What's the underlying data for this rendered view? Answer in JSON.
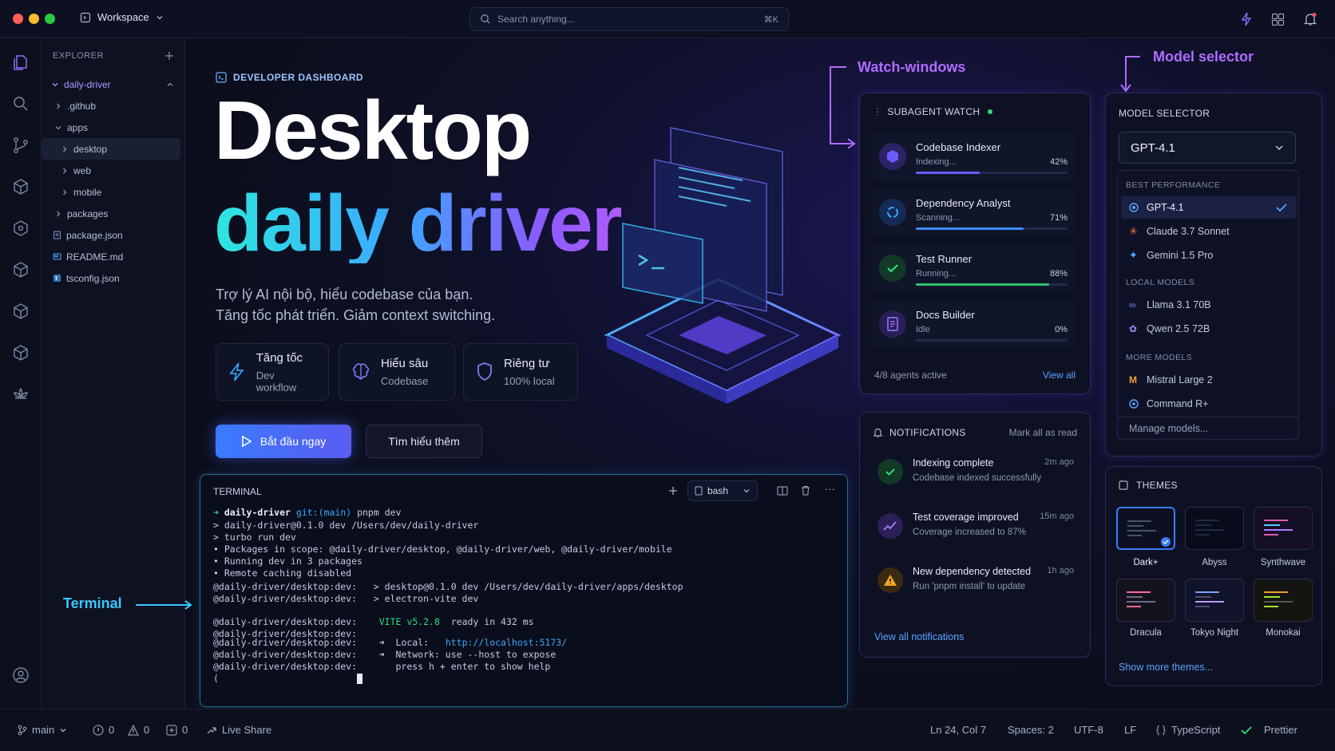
{
  "titlebar": {
    "workspace": "Workspace",
    "search_placeholder": "Search anything...",
    "search_shortcut": "⌘K"
  },
  "explorer": {
    "title": "EXPLORER",
    "items": [
      {
        "label": "daily-driver",
        "icon": "chevron-down-icon"
      },
      {
        "label": ".github",
        "icon": "chevron-right-icon"
      },
      {
        "label": "apps",
        "icon": "chevron-down-icon"
      },
      {
        "label": "desktop",
        "icon": "chevron-right-icon"
      },
      {
        "label": "web",
        "icon": "chevron-right-icon"
      },
      {
        "label": "mobile",
        "icon": "chevron-right-icon"
      },
      {
        "label": "packages",
        "icon": "chevron-right-icon"
      },
      {
        "label": "package.json",
        "icon": "json-file-icon"
      },
      {
        "label": "README.md",
        "icon": "markdown-file-icon"
      },
      {
        "label": "tsconfig.json",
        "icon": "ts-file-icon"
      }
    ]
  },
  "hero": {
    "label": "DEVELOPER DASHBOARD",
    "title": "Desktop",
    "title_gradient": "daily driver",
    "sub1": "Trợ lý AI nội bộ, hiểu codebase của bạn.",
    "sub2": "Tăng tốc phát triển. Giảm context switching.",
    "features": [
      {
        "title": "Tăng tốc",
        "sub": "Dev workflow",
        "icon": "lightning-icon"
      },
      {
        "title": "Hiểu sâu",
        "sub": "Codebase",
        "icon": "brain-icon"
      },
      {
        "title": "Riêng tư",
        "sub": "100% local",
        "icon": "shield-icon"
      }
    ],
    "cta_primary": "Bắt đầu ngay",
    "cta_secondary": "Tìm hiểu thêm"
  },
  "terminal": {
    "title": "TERMINAL",
    "shell": "bash",
    "prompt_dir": "daily-driver",
    "prompt_git": "git:(main)",
    "prompt_cmd": "pnpm dev",
    "lines": [
      "> daily-driver@0.1.0 dev /Users/dev/daily-driver",
      "> turbo run dev",
      "• Packages in scope: @daily-driver/desktop, @daily-driver/web, @daily-driver/mobile",
      "• Running dev in 3 packages",
      "• Remote caching disabled",
      "@daily-driver/desktop:dev:   > desktop@0.1.0 dev /Users/dev/daily-driver/apps/desktop",
      "@daily-driver/desktop:dev:   > electron-vite dev"
    ],
    "vite_prefix": "@daily-driver/desktop:dev:",
    "vite_ver": "VITE v5.2.8",
    "vite_ready": "ready in 432 ms",
    "local_label": "➜  Local:",
    "local_url": "http://localhost:5173/",
    "network_line": "➜  Network: use --host to expose",
    "help_line": "press h + enter to show help"
  },
  "annotations": {
    "watch": "Watch-windows",
    "model": "Model selector",
    "terminal": "Terminal"
  },
  "watch": {
    "title": "SUBAGENT WATCH",
    "agents": [
      {
        "name": "Codebase Indexer",
        "status": "Indexing...",
        "pct": "42%",
        "progress": 0.42,
        "color": "#6a5cff"
      },
      {
        "name": "Dependency Analyst",
        "status": "Scanning...",
        "pct": "71%",
        "progress": 0.71,
        "color": "#3a8cff"
      },
      {
        "name": "Test Runner",
        "status": "Running...",
        "pct": "88%",
        "progress": 0.88,
        "color": "#2fc46a"
      },
      {
        "name": "Docs Builder",
        "status": "Idle",
        "pct": "0%",
        "progress": 0,
        "color": "#8a5bff"
      }
    ],
    "footer": "4/8 agents active",
    "view_all": "View all"
  },
  "notifications": {
    "title": "NOTIFICATIONS",
    "mark_read": "Mark all as read",
    "items": [
      {
        "title": "Indexing complete",
        "sub": "Codebase indexed successfully",
        "time": "2m ago",
        "icon": "check-icon"
      },
      {
        "title": "Test coverage improved",
        "sub": "Coverage increased to 87%",
        "time": "15m ago",
        "icon": "trend-up-icon"
      },
      {
        "title": "New dependency detected",
        "sub": "Run 'pnpm install' to update",
        "time": "1h ago",
        "icon": "warning-icon"
      }
    ],
    "view_all": "View all notifications"
  },
  "models": {
    "title": "MODEL SELECTOR",
    "selected": "GPT-4.1",
    "group1": "BEST PERFORMANCE",
    "group2": "LOCAL MODELS",
    "group3": "MORE MODELS",
    "best": [
      "GPT-4.1",
      "Claude 3.7 Sonnet",
      "Gemini 1.5 Pro"
    ],
    "local": [
      "Llama 3.1 70B",
      "Qwen 2.5 72B"
    ],
    "more": [
      "Mistral Large 2",
      "Command R+"
    ],
    "manage": "Manage models..."
  },
  "themes": {
    "title": "THEMES",
    "items": [
      "Dark+",
      "Abyss",
      "Synthwave",
      "Dracula",
      "Tokyo Night",
      "Monokai"
    ],
    "more": "Show more themes..."
  },
  "statusbar": {
    "branch": "main",
    "errors": "0",
    "warnings": "0",
    "info": "0",
    "live_share": "Live Share",
    "position": "Ln 24, Col 7",
    "spaces": "Spaces: 2",
    "encoding": "UTF-8",
    "eol": "LF",
    "language": "TypeScript",
    "formatter": "Prettier"
  }
}
